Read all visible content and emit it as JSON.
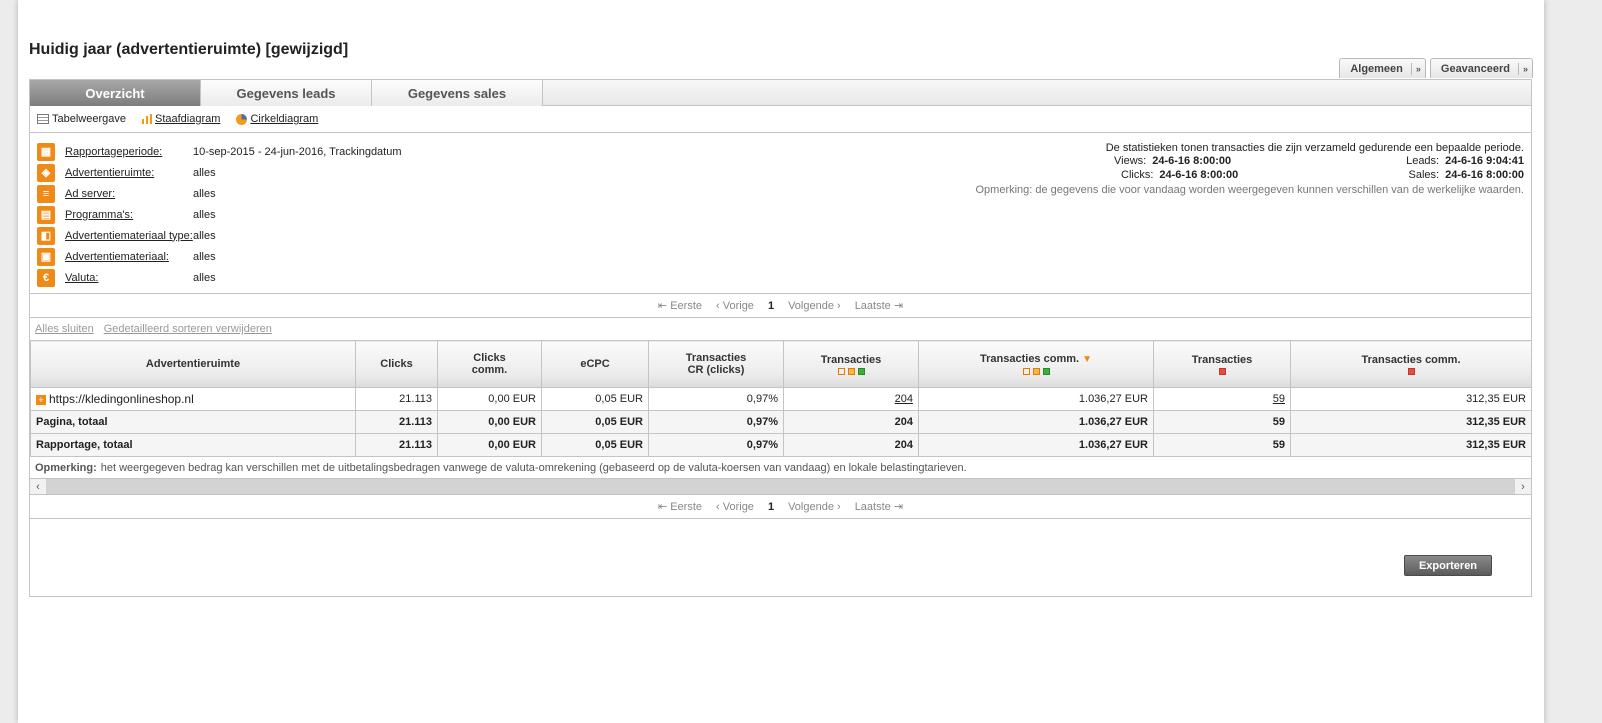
{
  "page": {
    "title": "Huidig jaar (advertentieruimte) [gewijzigd]",
    "menus": [
      {
        "label": "Algemeen"
      },
      {
        "label": "Geavanceerd"
      }
    ]
  },
  "tabs": [
    {
      "label": "Overzicht",
      "active": true
    },
    {
      "label": "Gegevens leads",
      "active": false
    },
    {
      "label": "Gegevens sales",
      "active": false
    }
  ],
  "views": {
    "table": "Tabelweergave",
    "bar": "Staafdiagram",
    "pie": "Cirkeldiagram"
  },
  "filters": [
    {
      "label": "Rapportageperiode:",
      "value": "10-sep-2015 - 24-jun-2016, Trackingdatum",
      "icon": "calendar-icon"
    },
    {
      "label": "Advertentieruimte:",
      "value": "alles",
      "icon": "adspace-icon"
    },
    {
      "label": "Ad server:",
      "value": "alles",
      "icon": "adserver-icon"
    },
    {
      "label": "Programma's:",
      "value": "alles",
      "icon": "programs-icon"
    },
    {
      "label": "Advertentiemateriaal type:",
      "value": "alles",
      "icon": "material-type-icon"
    },
    {
      "label": "Advertentiemateriaal:",
      "value": "alles",
      "icon": "material-icon"
    },
    {
      "label": "Valuta:",
      "value": "alles",
      "icon": "euro-icon"
    }
  ],
  "stats": {
    "intro": "De statistieken tonen transacties die zijn verzameld gedurende een bepaalde periode.",
    "views_label": "Views:",
    "views_value": "24-6-16 8:00:00",
    "clicks_label": "Clicks:",
    "clicks_value": "24-6-16 8:00:00",
    "leads_label": "Leads:",
    "leads_value": "24-6-16 9:04:41",
    "sales_label": "Sales:",
    "sales_value": "24-6-16 8:00:00",
    "note": "Opmerking: de gegevens die voor vandaag worden weergegeven kunnen verschillen van de werkelijke waarden."
  },
  "pager": {
    "first": "Eerste",
    "prev": "Vorige",
    "current": "1",
    "next": "Volgende",
    "last": "Laatste"
  },
  "links": {
    "close_all": "Alles sluiten",
    "remove_sort": "Gedetailleerd sorteren verwijderen"
  },
  "table": {
    "headers": {
      "adspace": "Advertentieruimte",
      "clicks": "Clicks",
      "clicks_comm_1": "Clicks",
      "clicks_comm_2": "comm.",
      "ecpc": "eCPC",
      "cr_1": "Transacties",
      "cr_2": "CR (clicks)",
      "trans_open": "Transacties",
      "trans_comm_open": "Transacties comm.",
      "trans_rej": "Transacties",
      "trans_comm_rej": "Transacties comm."
    },
    "rows": [
      {
        "name": "https://kledingonlineshop.nl",
        "clicks": "21.113",
        "clicks_comm": "0,00 EUR",
        "ecpc": "0,05 EUR",
        "cr": "0,97%",
        "trans": "204",
        "trans_comm": "1.036,27 EUR",
        "trans_rej": "59",
        "trans_comm_rej": "312,35 EUR"
      },
      {
        "name": "Pagina, totaal",
        "clicks": "21.113",
        "clicks_comm": "0,00 EUR",
        "ecpc": "0,05 EUR",
        "cr": "0,97%",
        "trans": "204",
        "trans_comm": "1.036,27 EUR",
        "trans_rej": "59",
        "trans_comm_rej": "312,35 EUR"
      },
      {
        "name": "Rapportage, totaal",
        "clicks": "21.113",
        "clicks_comm": "0,00 EUR",
        "ecpc": "0,05 EUR",
        "cr": "0,97%",
        "trans": "204",
        "trans_comm": "1.036,27 EUR",
        "trans_rej": "59",
        "trans_comm_rej": "312,35 EUR"
      }
    ]
  },
  "remark": {
    "label": "Opmerking:",
    "text": "het weergegeven bedrag kan verschillen met de uitbetalingsbedragen vanwege de valuta-omrekening (gebaseerd op de valuta-koersen van vandaag) en lokale belastingtarieven."
  },
  "export_label": "Exporteren",
  "colors": {
    "accent": "#f08a16",
    "tab_active": "#8c8c8c",
    "status_green": "#3ab03a",
    "status_red": "#e84c3d"
  }
}
